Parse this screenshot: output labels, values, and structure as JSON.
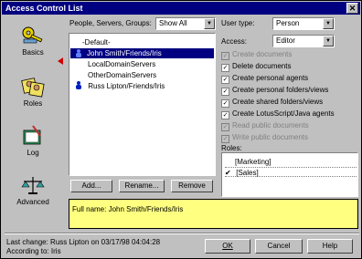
{
  "window": {
    "title": "Access Control List"
  },
  "sidebar": {
    "items": [
      {
        "label": "Basics",
        "icon": "key-icon"
      },
      {
        "label": "Roles",
        "icon": "people-icon"
      },
      {
        "label": "Log",
        "icon": "log-book-icon"
      },
      {
        "label": "Advanced",
        "icon": "scales-icon"
      }
    ]
  },
  "people": {
    "label": "People, Servers, Groups:",
    "filter_value": "Show All",
    "list": [
      {
        "name": "-Default-",
        "type": "none"
      },
      {
        "name": "John Smith/Friends/Iris",
        "type": "person",
        "selected": true
      },
      {
        "name": "LocalDomainServers",
        "type": "none"
      },
      {
        "name": "OtherDomainServers",
        "type": "none"
      },
      {
        "name": "Russ Lipton/Friends/Iris",
        "type": "person"
      }
    ],
    "buttons": {
      "add": "Add...",
      "rename": "Rename...",
      "remove": "Remove"
    }
  },
  "user_type": {
    "label": "User type:",
    "value": "Person"
  },
  "access": {
    "label": "Access:",
    "value": "Editor"
  },
  "permissions": [
    {
      "label": "Create documents",
      "checked": true,
      "enabled": false
    },
    {
      "label": "Delete documents",
      "checked": true,
      "enabled": true
    },
    {
      "label": "Create personal agents",
      "checked": true,
      "enabled": true
    },
    {
      "label": "Create personal folders/views",
      "checked": true,
      "enabled": true
    },
    {
      "label": "Create shared folders/views",
      "checked": true,
      "enabled": true
    },
    {
      "label": "Create LotusScript/Java agents",
      "checked": true,
      "enabled": true
    },
    {
      "label": "Read public documents",
      "checked": true,
      "enabled": false
    },
    {
      "label": "Write public documents",
      "checked": true,
      "enabled": false
    }
  ],
  "roles": {
    "label": "Roles:",
    "items": [
      {
        "name": "[Marketing]",
        "checked": false
      },
      {
        "name": "[Sales]",
        "checked": true
      }
    ]
  },
  "full_name": "Full name: John Smith/Friends/Iris",
  "footer": {
    "last_change": "Last change: Russ Lipton on 03/17/98 04:04:28",
    "according_to": "According to: Iris",
    "ok": "OK",
    "cancel": "Cancel",
    "help": "Help"
  }
}
